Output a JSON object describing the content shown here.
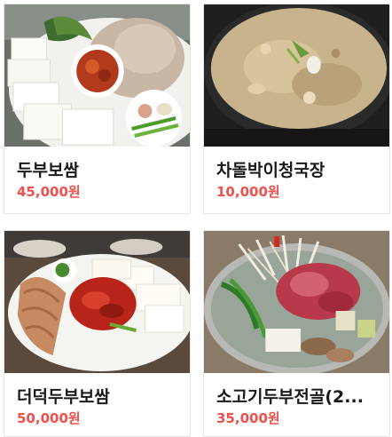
{
  "menu": {
    "items": [
      {
        "name": "두부보쌈",
        "price": "45,000원",
        "image": "tofu-bossam-photo"
      },
      {
        "name": "차돌박이청국장",
        "price": "10,000원",
        "image": "cheonggukjang-stew-photo"
      },
      {
        "name": "더덕두부보쌈",
        "price": "50,000원",
        "image": "deodeok-tofu-bossam-photo"
      },
      {
        "name": "소고기두부전골(2...",
        "price": "35,000원",
        "image": "beef-tofu-hotpot-photo"
      }
    ]
  },
  "colors": {
    "price": "#f0504a",
    "title": "#1a1a1a",
    "border": "#e5e5e5"
  }
}
